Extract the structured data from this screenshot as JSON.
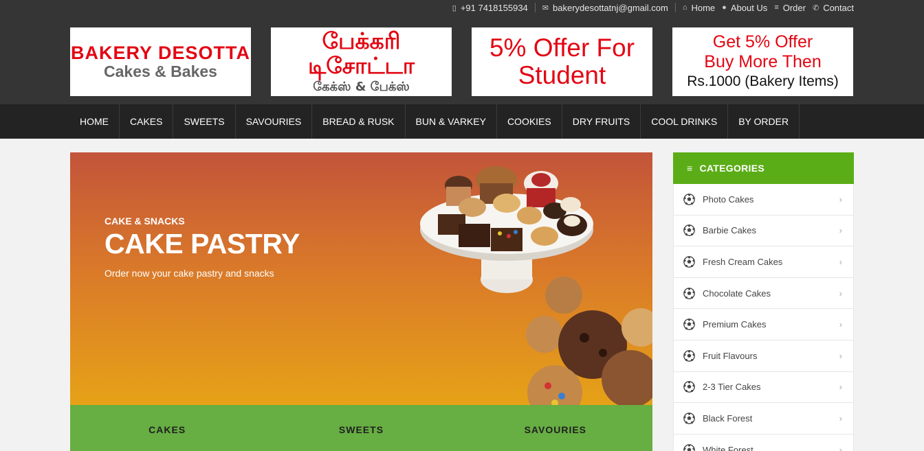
{
  "topbar": {
    "phone": "+91 7418155934",
    "email": "bakerydesottatnj@gmail.com",
    "links": [
      "Home",
      "About Us",
      "Order",
      "Contact"
    ]
  },
  "banners": {
    "b1": {
      "line1": "BAKERY DESOTTA",
      "line2": "Cakes & Bakes"
    },
    "b2": {
      "line1": "பேக்கரி டிசோட்டா",
      "line2": "கேக்ஸ் & பேக்ஸ்"
    },
    "b3": {
      "line1": "5% Offer For",
      "line2": "Student"
    },
    "b4": {
      "line1": "Get 5% Offer",
      "line2": "Buy More Then",
      "line3": "Rs.1000 (Bakery Items)"
    }
  },
  "nav": [
    "HOME",
    "CAKES",
    "SWEETS",
    "SAVOURIES",
    "BREAD & RUSK",
    "BUN & VARKEY",
    "COOKIES",
    "DRY FRUITS",
    "COOL DRINKS",
    "BY ORDER"
  ],
  "hero": {
    "kicker": "CAKE & SNACKS",
    "title": "CAKE PASTRY",
    "subtitle": "Order now your cake pastry and snacks"
  },
  "category_strip": [
    "CAKES",
    "SWEETS",
    "SAVOURIES"
  ],
  "sidebar": {
    "heading": "CATEGORIES",
    "items": [
      "Photo Cakes",
      "Barbie Cakes",
      "Fresh Cream Cakes",
      "Chocolate Cakes",
      "Premium Cakes",
      "Fruit Flavours",
      "2-3 Tier Cakes",
      "Black Forest",
      "White Forest"
    ]
  },
  "colors": {
    "header_bg": "#353535",
    "nav_bg": "#232323",
    "accent_green": "#5bad17",
    "strip_green": "#67ae43",
    "brand_red": "#e30613"
  }
}
